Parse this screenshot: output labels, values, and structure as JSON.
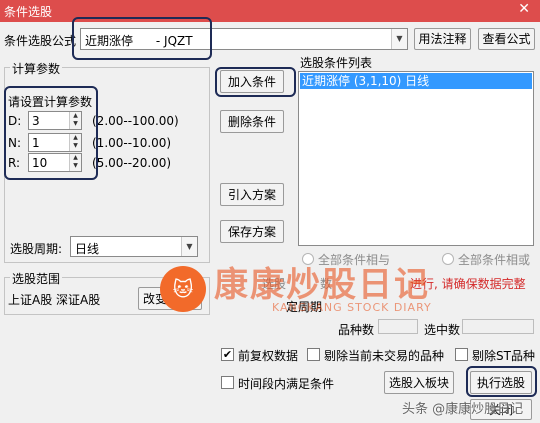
{
  "window": {
    "title": "条件选股",
    "close_glyph": "✕"
  },
  "formula": {
    "label": "条件选股公式",
    "value": "近期涨停      - JQZT",
    "usage_button": "用法注释",
    "view_button": "查看公式"
  },
  "params": {
    "legend": "计算参数",
    "prompt": "请设置计算参数",
    "rows": [
      {
        "label": "D:",
        "value": "3",
        "range": "(2.00--100.00)"
      },
      {
        "label": "N:",
        "value": "1",
        "range": "(1.00--10.00)"
      },
      {
        "label": "R:",
        "value": "10",
        "range": "(5.00--20.00)"
      }
    ],
    "period_label": "选股周期:",
    "period_value": "日线"
  },
  "actions": {
    "add": "加入条件",
    "delete": "删除条件",
    "import": "引入方案",
    "save": "保存方案"
  },
  "conditions": {
    "label": "选股条件列表",
    "items": [
      "近期涨停 (3,1,10) 日线"
    ],
    "and_option": "全部条件相与",
    "or_option": "全部条件相或"
  },
  "scope": {
    "legend": "选股范围",
    "value": "上证A股 深证A股",
    "change_button": "改变"
  },
  "notice": {
    "part1": "选股",
    "part2": "数",
    "part3": "进行, 请确保数据完整"
  },
  "period_check_label": "定周期",
  "stats": {
    "count_label": "品种数",
    "selected_label": "选中数"
  },
  "options": {
    "adjust": {
      "label": "前复权数据",
      "checked": true
    },
    "exclude_untraded": {
      "label": "剔除当前未交易的品种",
      "checked": false
    },
    "exclude_st": {
      "label": "剔除ST品种",
      "checked": false
    },
    "time_range": {
      "label": "时间段内满足条件",
      "checked": false
    }
  },
  "footer": {
    "to_board": "选股入板块",
    "run": "执行选股",
    "close": "关闭"
  },
  "watermark": {
    "logo_glyph": "🐱",
    "text": "康康炒股日记",
    "sub": "KANGKANG STOCK DIARY",
    "source": "头条 @康康炒股日记"
  },
  "colors": {
    "titlebar": "#dd4d4c",
    "selection": "#3399ff",
    "highlight": "#1e2b56",
    "warning": "#d42a2a"
  }
}
